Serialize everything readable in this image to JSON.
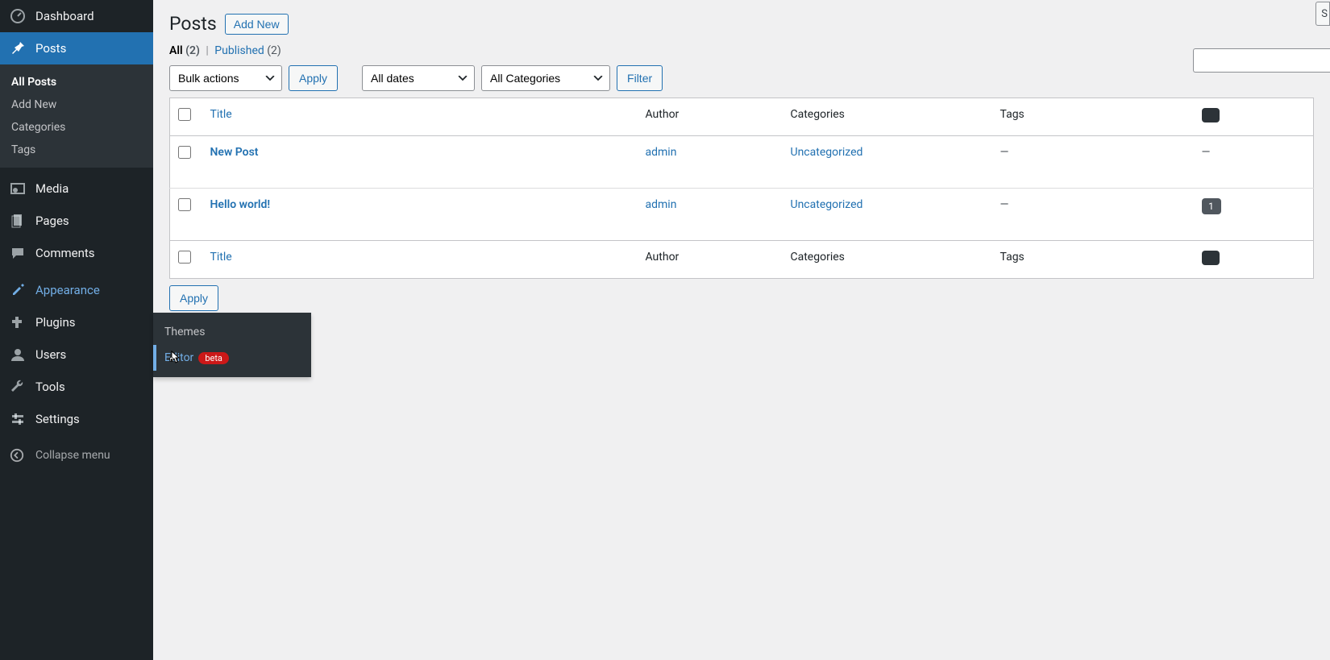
{
  "sidebar": {
    "dashboard": "Dashboard",
    "posts": "Posts",
    "posts_submenu": {
      "all_posts": "All Posts",
      "add_new": "Add New",
      "categories": "Categories",
      "tags": "Tags"
    },
    "media": "Media",
    "pages": "Pages",
    "comments": "Comments",
    "appearance": "Appearance",
    "appearance_flyout": {
      "themes": "Themes",
      "editor": "Editor",
      "editor_badge": "beta"
    },
    "plugins": "Plugins",
    "users": "Users",
    "tools": "Tools",
    "settings": "Settings",
    "collapse": "Collapse menu"
  },
  "header": {
    "title": "Posts",
    "add_new": "Add New"
  },
  "filters": {
    "all_label": "All",
    "all_count": "(2)",
    "published_label": "Published",
    "published_count": "(2)"
  },
  "controls": {
    "bulk_actions": "Bulk actions",
    "apply": "Apply",
    "all_dates": "All dates",
    "all_categories": "All Categories",
    "filter": "Filter"
  },
  "columns": {
    "title": "Title",
    "author": "Author",
    "categories": "Categories",
    "tags": "Tags"
  },
  "rows": [
    {
      "title": "New Post",
      "author": "admin",
      "categories": "Uncategorized",
      "tags": "—",
      "comments": 0
    },
    {
      "title": "Hello world!",
      "author": "admin",
      "categories": "Uncategorized",
      "tags": "—",
      "comments": 1
    }
  ],
  "search_button_fragment": "S"
}
